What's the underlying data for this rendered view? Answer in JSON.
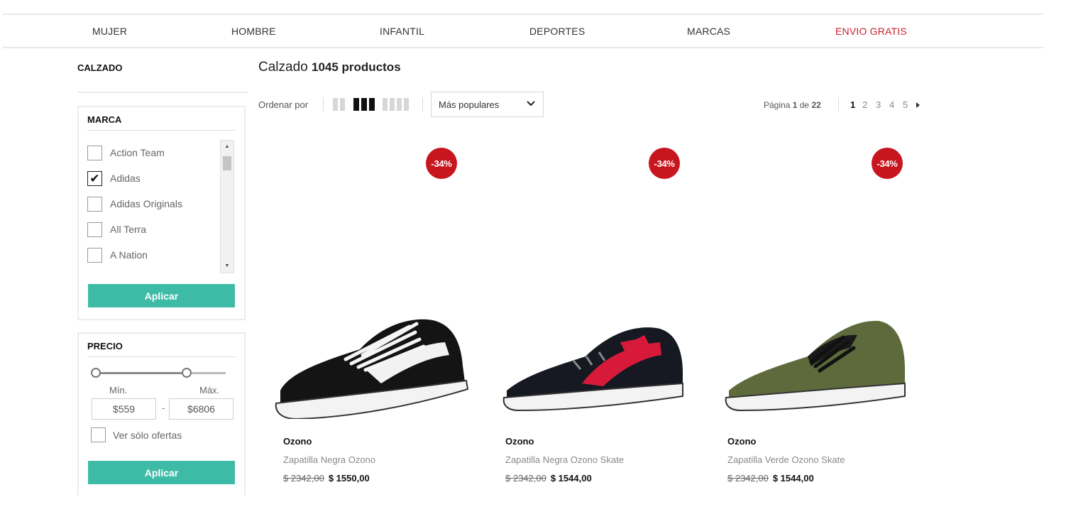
{
  "nav": {
    "items": [
      {
        "label": "MUJER",
        "highlight": false
      },
      {
        "label": "HOMBRE",
        "highlight": false
      },
      {
        "label": "INFANTIL",
        "highlight": false
      },
      {
        "label": "DEPORTES",
        "highlight": false
      },
      {
        "label": "MARCAS",
        "highlight": false
      },
      {
        "label": "ENVIO GRATIS",
        "highlight": true
      }
    ]
  },
  "sidebar": {
    "title": "CALZADO",
    "brand_filter": {
      "heading": "MARCA",
      "items": [
        {
          "label": "Action Team",
          "checked": false
        },
        {
          "label": "Adidas",
          "checked": true
        },
        {
          "label": "Adidas Originals",
          "checked": false
        },
        {
          "label": "All Terra",
          "checked": false
        },
        {
          "label": "A Nation",
          "checked": false
        },
        {
          "label": "",
          "checked": false
        }
      ],
      "apply_label": "Aplicar"
    },
    "price_filter": {
      "heading": "PRECIO",
      "min_label": "Mín.",
      "max_label": "Máx.",
      "min_value": "$559",
      "max_value": "$6806",
      "separator": "-",
      "range_fraction": [
        0.0,
        0.7
      ],
      "offers_label": "Ver sólo ofertas",
      "offers_checked": false,
      "apply_label": "Aplicar"
    }
  },
  "main": {
    "title": "Calzado",
    "count": "1045 productos",
    "sort_label": "Ordenar por",
    "sort_selected": "Más populares",
    "pagination": {
      "prefix": "Página",
      "current": "1",
      "of_word": "de",
      "total": "22",
      "pages": [
        "1",
        "2",
        "3",
        "4",
        "5"
      ]
    },
    "products": [
      {
        "badge": "-34%",
        "brand": "Ozono",
        "name": "Zapatilla Negra Ozono",
        "old_price": "$ 2342,00",
        "price": "$ 1550,00",
        "color": "#141414"
      },
      {
        "badge": "-34%",
        "brand": "Ozono",
        "name": "Zapatilla Negra Ozono Skate",
        "old_price": "$ 2342,00",
        "price": "$ 1544,00",
        "color": "#161922"
      },
      {
        "badge": "-34%",
        "brand": "Ozono",
        "name": "Zapatilla Verde Ozono Skate",
        "old_price": "$ 2342,00",
        "price": "$ 1544,00",
        "color": "#5e6a3c"
      }
    ]
  },
  "colors": {
    "accent_button": "#3ebba6",
    "badge": "#c8161f",
    "nav_highlight": "#c8202a"
  }
}
